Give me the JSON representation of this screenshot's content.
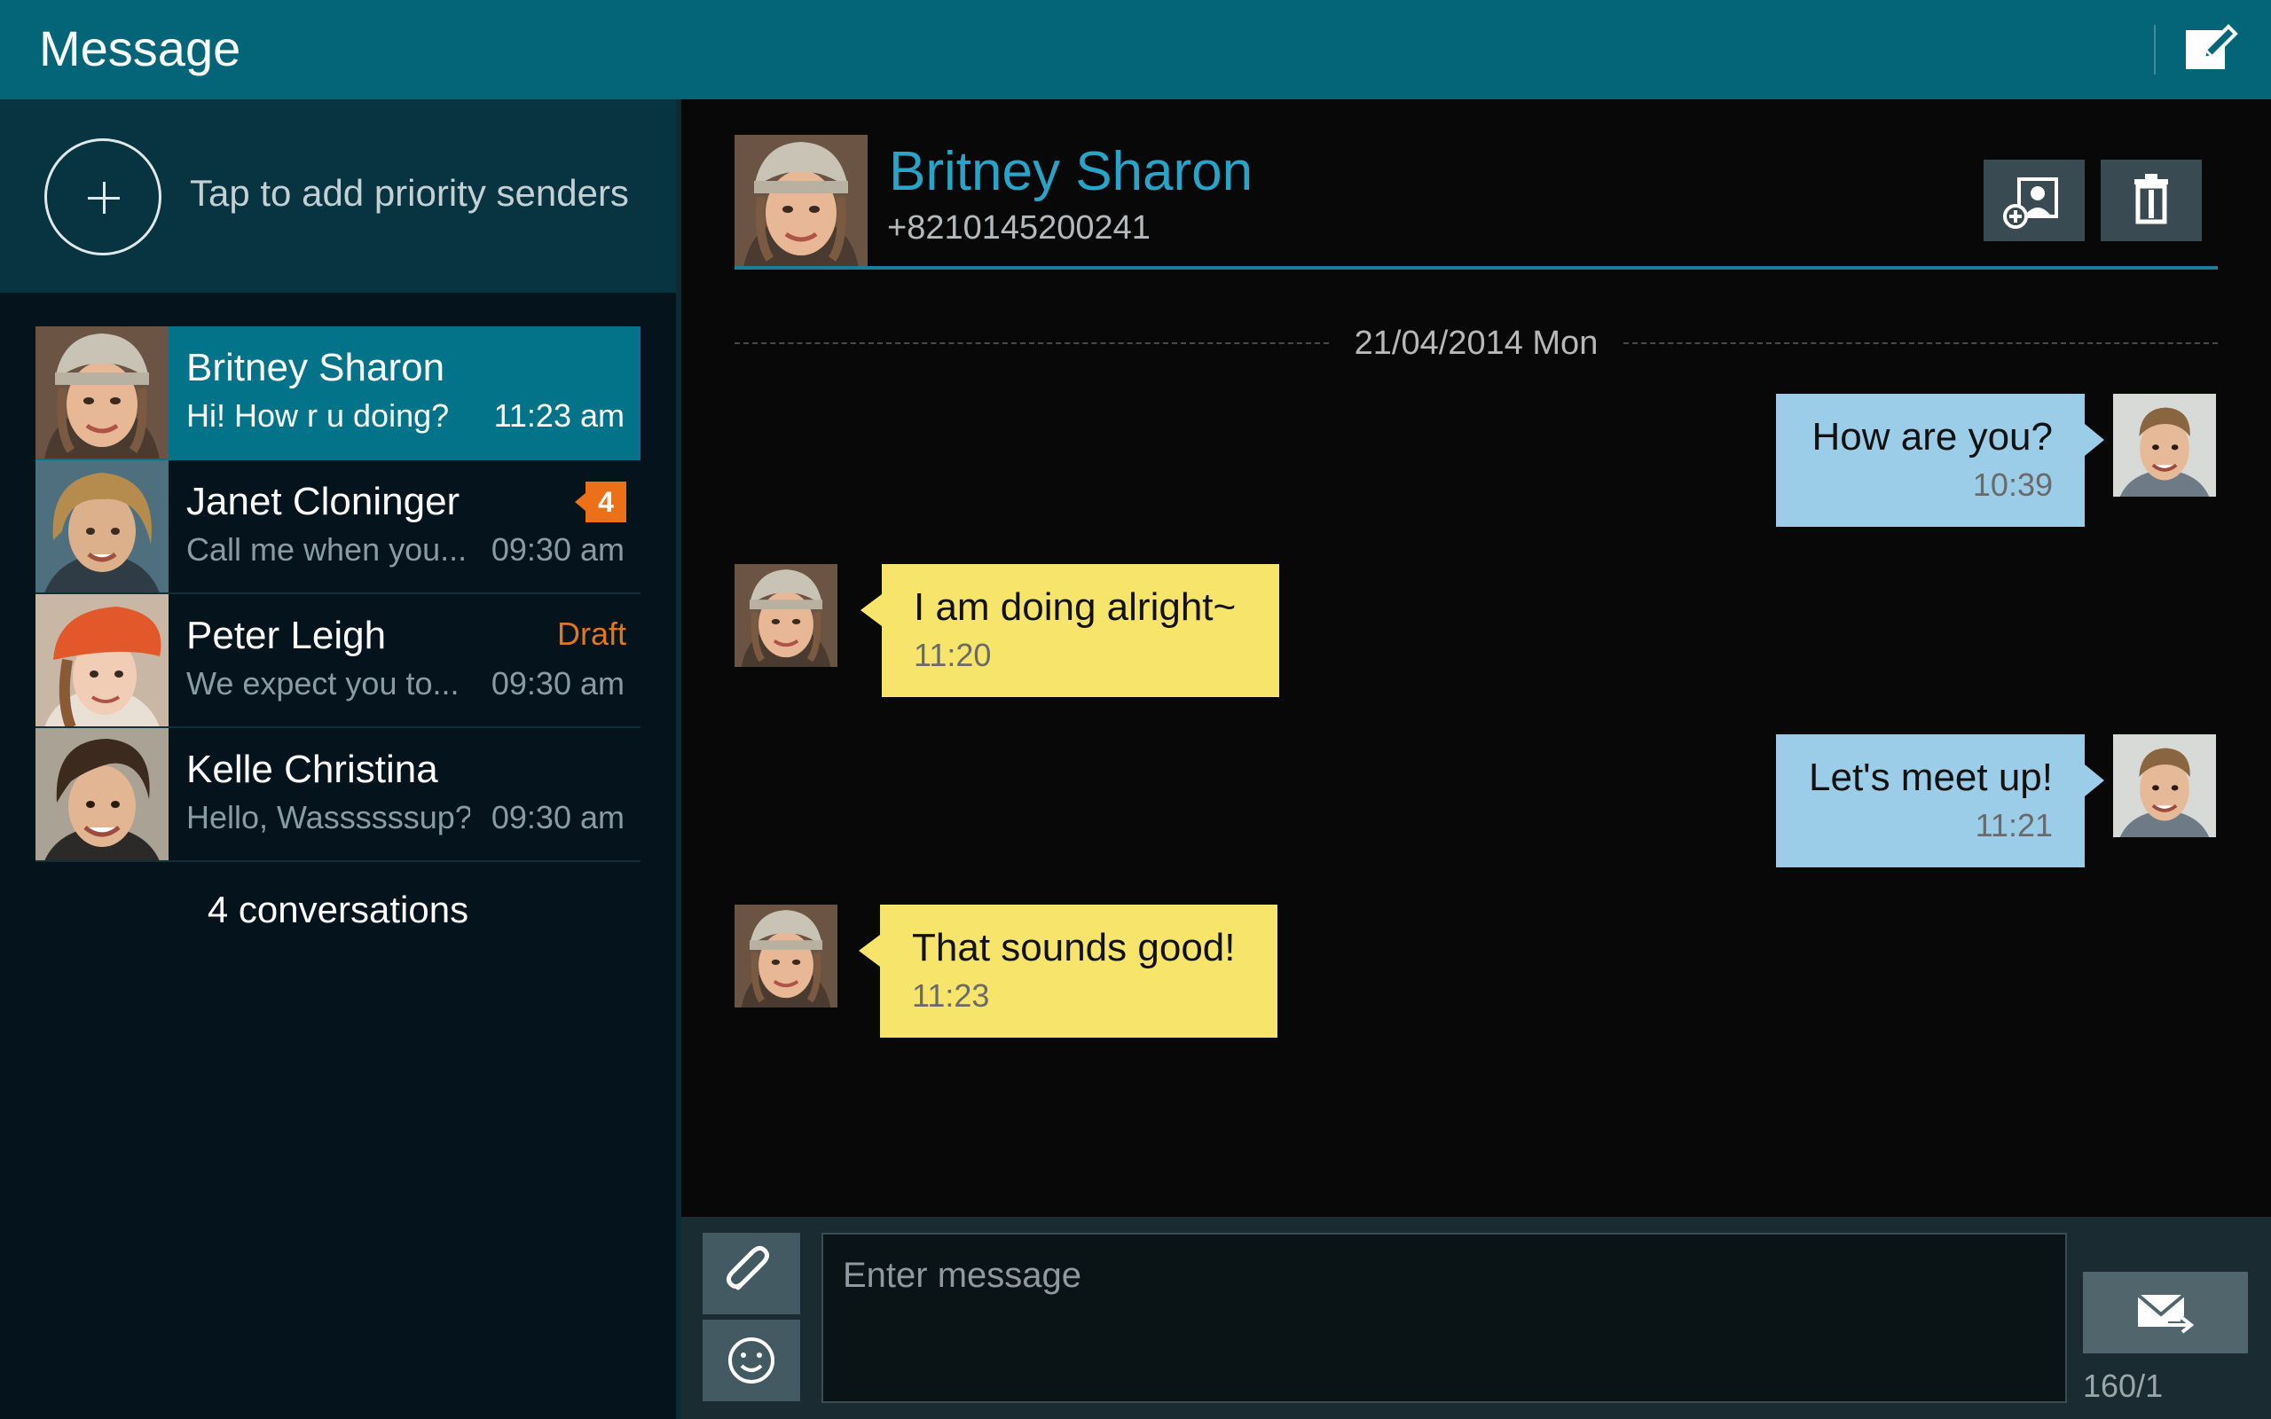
{
  "app": {
    "title": "Message"
  },
  "toolbar": {
    "compose_icon": "compose-icon"
  },
  "priority": {
    "label": "Tap to add priority senders",
    "icon": "plus-icon"
  },
  "conversations": [
    {
      "name": "Britney Sharon",
      "preview": "Hi! How r u doing?",
      "time": "11:23 am",
      "selected": true
    },
    {
      "name": "Janet Cloninger",
      "preview": "Call me when you...",
      "time": "09:30 am",
      "badge": "4"
    },
    {
      "name": "Peter Leigh",
      "preview": "We expect you to...",
      "time": "09:30 am",
      "status": "Draft"
    },
    {
      "name": "Kelle Christina",
      "preview": "Hello, Wassssssup?!",
      "time": "09:30 am"
    }
  ],
  "conversation_count": "4 conversations",
  "contact": {
    "name": "Britney Sharon",
    "number": "+8210145200241"
  },
  "date_divider": "21/04/2014 Mon",
  "messages": [
    {
      "direction": "out",
      "text": "How are you?",
      "time": "10:39"
    },
    {
      "direction": "in",
      "text": "I am doing alright~",
      "time": "11:20"
    },
    {
      "direction": "out",
      "text": "Let's meet up!",
      "time": "11:21"
    },
    {
      "direction": "in",
      "text": "That sounds good!",
      "time": "11:23"
    }
  ],
  "composer": {
    "placeholder": "Enter message",
    "char_count": "160/1"
  },
  "colors": {
    "title_bar": "#046579",
    "accent": "#29a3c7",
    "selected_row": "#03738a",
    "outgoing_bubble": "#9ccde8",
    "incoming_bubble": "#f7e56b",
    "badge": "#ec7018"
  }
}
